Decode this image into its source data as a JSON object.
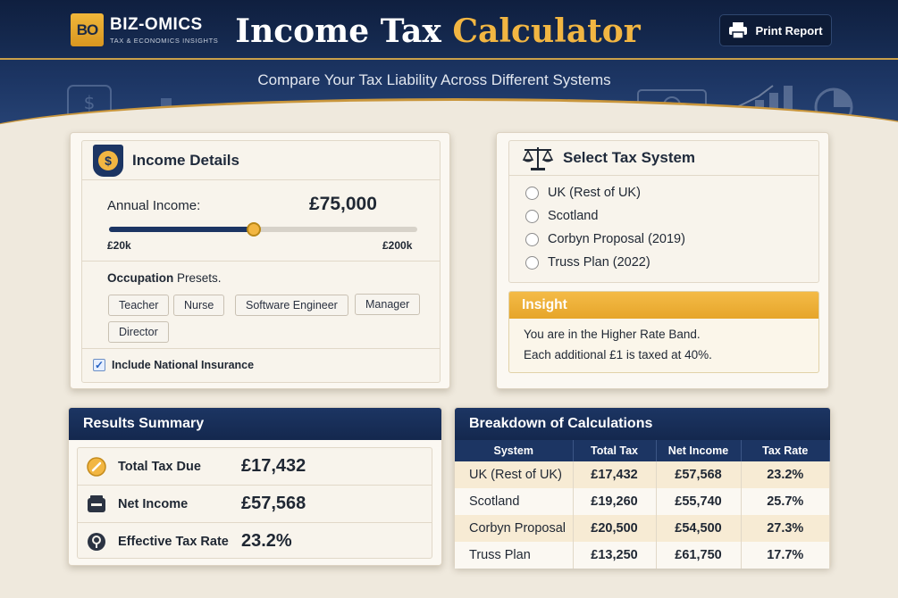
{
  "brand": {
    "logo_mark": "BO",
    "name": "BIZ-OMICS",
    "tagline": "TAX & ECONOMICS INSIGHTS"
  },
  "header": {
    "title_main": "Income Tax",
    "title_accent": "Calculator",
    "subtitle": "Compare Your Tax Liability Across Different Systems",
    "print_label": "Print Report"
  },
  "income": {
    "title": "Income Details",
    "icon": "dollar-icon",
    "annual_label": "Annual Income:",
    "annual_value": "£75,000",
    "slider": {
      "min_label": "£20k",
      "max_label": "£200k",
      "fraction": 0.47
    },
    "presets_label_bold": "Occupation",
    "presets_label_rest": " Presets.",
    "presets": [
      "Teacher",
      "Nurse",
      "Software Engineer",
      "Manager",
      "Director"
    ],
    "include_ni_label": "Include National Insurance",
    "include_ni_checked": true
  },
  "tax_system": {
    "title": "Select Tax System",
    "options": [
      "UK (Rest of UK)",
      "Scotland",
      "Corbyn Proposal (2019)",
      "Truss Plan (2022)"
    ]
  },
  "insight": {
    "title": "Insight",
    "line1": "You are in the Higher Rate Band.",
    "line2": "Each additional £1 is taxed at 40%."
  },
  "results": {
    "title": "Results Summary",
    "rows": [
      {
        "label": "Total Tax Due",
        "value": "£17,432",
        "icon": "coin-icon"
      },
      {
        "label": "Net Income",
        "value": "£57,568",
        "icon": "wallet-icon"
      },
      {
        "label": "Effective Tax Rate",
        "value": "23.2%",
        "icon": "percent-icon"
      }
    ]
  },
  "breakdown": {
    "title": "Breakdown of Calculations",
    "columns": [
      "System",
      "Total Tax",
      "Net Income",
      "Tax Rate"
    ],
    "rows": [
      [
        "UK (Rest of UK)",
        "£17,432",
        "£57,568",
        "23.2%"
      ],
      [
        "Scotland",
        "£19,260",
        "£55,740",
        "25.7%"
      ],
      [
        "Corbyn Proposal",
        "£20,500",
        "£54,500",
        "27.3%"
      ],
      [
        "Truss Plan",
        "£13,250",
        "£61,750",
        "17.7%"
      ]
    ]
  },
  "colors": {
    "navy": "#1c3563",
    "gold": "#f2b642",
    "cream": "#efe9dd"
  }
}
